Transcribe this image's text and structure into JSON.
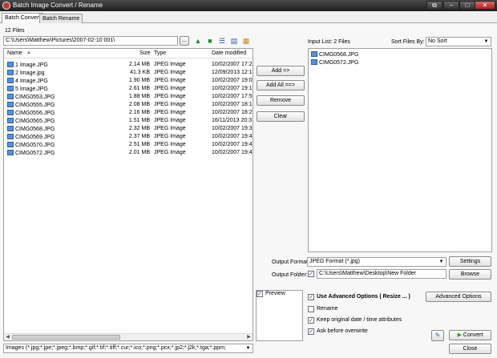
{
  "window": {
    "title": "Batch Image Convert / Rename"
  },
  "title_buttons": {
    "restore": "⧉",
    "minimize": "‒",
    "maximize": "□",
    "close": "✕"
  },
  "tabs": [
    {
      "label": "Batch Convert",
      "active": true
    },
    {
      "label": "Batch Rename",
      "active": false
    }
  ],
  "file_count": "12 Files",
  "path": {
    "value": "C:\\Users\\Matthew\\Pictures\\2007-02-10 001\\",
    "browse_label": "..."
  },
  "file_list": {
    "columns": {
      "name": "Name",
      "size": "Size",
      "type": "Type",
      "date": "Date modified"
    },
    "rows": [
      {
        "name": "1 Image.JPG",
        "size": "2.14 MB",
        "type": "JPEG Image",
        "date": "10/02/2007 17:2"
      },
      {
        "name": "2 Image.jpg",
        "size": "41.3 KB",
        "type": "JPEG Image",
        "date": "12/09/2013 12:1"
      },
      {
        "name": "4 Image.JPG",
        "size": "1.90 MB",
        "type": "JPEG Image",
        "date": "10/02/2007 19:0"
      },
      {
        "name": "5 Image.JPG",
        "size": "2.61 MB",
        "type": "JPEG Image",
        "date": "10/02/2007 19:1"
      },
      {
        "name": "CIMG0553.JPG",
        "size": "1.88 MB",
        "type": "JPEG Image",
        "date": "10/02/2007 17:5"
      },
      {
        "name": "CIMG0555.JPG",
        "size": "2.08 MB",
        "type": "JPEG Image",
        "date": "10/02/2007 18:1"
      },
      {
        "name": "CIMG0556.JPG",
        "size": "2.16 MB",
        "type": "JPEG Image",
        "date": "10/02/2007 18:2"
      },
      {
        "name": "CIMG0565.JPG",
        "size": "1.51 MB",
        "type": "JPEG Image",
        "date": "16/11/2013 20:3"
      },
      {
        "name": "CIMG0568.JPG",
        "size": "2.32 MB",
        "type": "JPEG Image",
        "date": "10/02/2007 19:3"
      },
      {
        "name": "CIMG0569.JPG",
        "size": "2.37 MB",
        "type": "JPEG Image",
        "date": "10/02/2007 19:4"
      },
      {
        "name": "CIMG0570.JPG",
        "size": "2.51 MB",
        "type": "JPEG Image",
        "date": "10/02/2007 19:4"
      },
      {
        "name": "CIMG0572.JPG",
        "size": "2.01 MB",
        "type": "JPEG Image",
        "date": "10/02/2007 19:4"
      }
    ]
  },
  "filter": {
    "value": "Images (*.jpg;*.jpe;*.jpeg;*.bmp;*.gif;*.tif;*.tiff;*.cur;*.ico;*.png;*.pcx;*.jp2;*.j2k;*.tga;*.ppm;"
  },
  "actions": {
    "add": "Add =>",
    "add_all": "Add All ==>",
    "remove": "Remove",
    "clear": "Clear"
  },
  "input_list": {
    "label": "Input List:  2 Files",
    "sort_label": "Sort Files By:",
    "sort_value": "No Sort",
    "items": [
      "CIMG0568.JPG",
      "CIMG0572.JPG"
    ]
  },
  "output": {
    "format_label": "Output Format:",
    "format_value": "JPEG Format (*.jpg)",
    "settings": "Settings",
    "folder_label": "Output Folder:",
    "folder_value": "C:\\Users\\Matthew\\Desktop\\New Folder",
    "browse": "Browse"
  },
  "preview": {
    "label": "Preview"
  },
  "options": {
    "use_advanced": "Use Advanced Options ( Resize ... )",
    "advanced_button": "Advanced Options",
    "rename": "Rename",
    "keep_date": "Keep original date / time attributes",
    "ask_overwrite": "Ask before overwrite"
  },
  "buttons": {
    "convert": "Convert",
    "close": "Close"
  },
  "colors": {
    "accent": "#2f5fa6",
    "convert_icon": "#2e9a2e",
    "title_bar": "#2a2a2a"
  }
}
